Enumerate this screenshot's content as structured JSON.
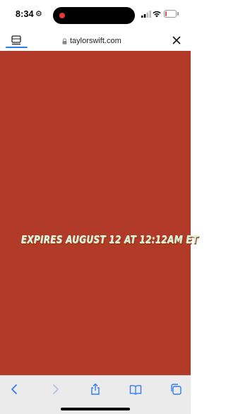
{
  "status_bar": {
    "time": "8:34",
    "battery_level": "17",
    "battery_fraction": 0.17,
    "recording_dot_color": "#e53935"
  },
  "address_bar": {
    "url": "taylorswift.com",
    "tab_icon": "tabs-list-icon",
    "close_icon": "close-icon"
  },
  "page": {
    "background_color": "#b23a28",
    "headline": "EXPIRES AUGUST 12 AT 12:12AM ET"
  },
  "toolbar": {
    "icons": [
      "back-icon",
      "forward-icon",
      "share-icon",
      "bookmarks-icon",
      "tabs-icon"
    ],
    "accent_color": "#2f7cf6"
  }
}
